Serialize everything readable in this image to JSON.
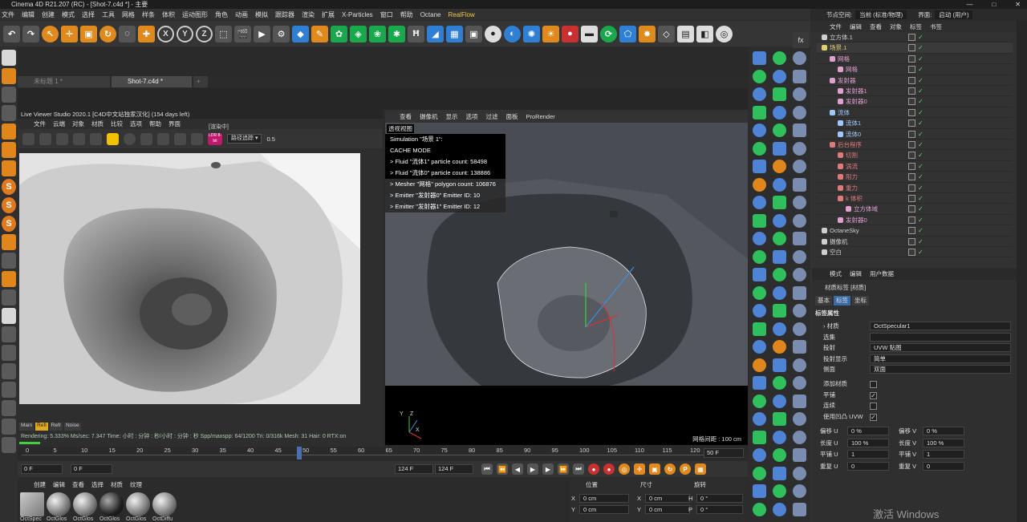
{
  "window": {
    "title": "Cinema 4D R21.207 (RC) - [Shot-7.c4d *] - 主要"
  },
  "menu": [
    "文件",
    "编辑",
    "创建",
    "模式",
    "选择",
    "工具",
    "网格",
    "样条",
    "体积",
    "运动图形",
    "角色",
    "动画",
    "模拟",
    "跟踪器",
    "渲染",
    "扩展",
    "X-Particles",
    "窗口",
    "帮助",
    "Octane",
    "RealFlow"
  ],
  "layout": {
    "node_space_label": "节点空间:",
    "node_space_value": "当前 (标准/物理)",
    "interface_label": "界面:",
    "interface_value": "启动 (用户)"
  },
  "axis_buttons": [
    "X",
    "Y",
    "Z"
  ],
  "doc_tabs": [
    {
      "label": "未标题 1 *"
    },
    {
      "label": "Shot-7.c4d *"
    },
    {
      "label": "+"
    }
  ],
  "live_viewer": {
    "title": "Live Viewer Studio 2020.1 [C4D中文站独家汉化] (154 days left)",
    "menu": [
      "文件",
      "云端",
      "对象",
      "材质",
      "比较",
      "选项",
      "帮助",
      "界面"
    ],
    "status_badge": "[渲染中]",
    "path_mode": "路径追踪",
    "value": "0.5",
    "ldr_label": "LDR 8-bit",
    "tabs": [
      "Main",
      "Refl",
      "Refr",
      "Noise"
    ],
    "status_line": "Rendering: 5.333%  Ms/sec: 7.347   Time: 小时 : 分钟 : 秒/小时 : 分钟 : 秒   Spp/maxspp: 64/1200   Tri: 0/316k   Mesh: 31   Hair: 0   RTX:on"
  },
  "viewport": {
    "menu": [
      "查看",
      "摄像机",
      "显示",
      "选项",
      "过滤",
      "面板",
      "ProRender"
    ],
    "label": "透视视图",
    "overlay_lines": [
      "Simulation \"场景 1\":",
      "CACHE MODE",
      " > Fluid \"流体1\" particle count: 58498",
      " > Fluid \"流体0\" particle count: 138886",
      " > Mesher \"网格\" polygon count: 106876",
      " > Emitter \"发射器0\" Emitter ID: 10",
      " > Emitter \"发射器1\" Emitter ID: 12"
    ],
    "grid_spacing": "网格间距 : 100 cm",
    "axis_labels": [
      "Y",
      "Z",
      "X"
    ]
  },
  "timeline": {
    "ticks": [
      "0",
      "5",
      "10",
      "15",
      "20",
      "25",
      "30",
      "35",
      "40",
      "45",
      "50",
      "55",
      "60",
      "65",
      "70",
      "75",
      "80",
      "85",
      "90",
      "95",
      "100",
      "105",
      "110",
      "115",
      "120"
    ],
    "end": "50 F"
  },
  "transport": {
    "start": "0 F",
    "current": "0 F",
    "end_a": "124 F",
    "end_b": "124 F"
  },
  "materials": {
    "menu": [
      "创建",
      "编辑",
      "查看",
      "选择",
      "材质",
      "纹理"
    ],
    "items": [
      "OctSpec",
      "OctGlos",
      "OctGlos",
      "OctGlos",
      "OctGlos",
      "OctDiffu"
    ]
  },
  "coords": {
    "headers": [
      "位置",
      "尺寸",
      "旋转"
    ],
    "rows": [
      {
        "a": "X",
        "av": "0 cm",
        "b": "X",
        "bv": "0 cm",
        "c": "H",
        "cv": "0 °"
      },
      {
        "a": "Y",
        "av": "0 cm",
        "b": "Y",
        "bv": "0 cm",
        "c": "P",
        "cv": "0 °"
      }
    ]
  },
  "objects": {
    "tabs": [
      "文件",
      "编辑",
      "查看",
      "对象",
      "标签",
      "书签"
    ],
    "items": [
      {
        "name": "立方体.1",
        "indent": 0,
        "color": "#cfcfcf"
      },
      {
        "name": "场景.1",
        "indent": 0,
        "color": "#e0d070"
      },
      {
        "name": "网格",
        "indent": 1,
        "color": "#e0a0d0"
      },
      {
        "name": "网格",
        "indent": 2,
        "color": "#e0a0d0"
      },
      {
        "name": "发射器",
        "indent": 1,
        "color": "#e0a0d0"
      },
      {
        "name": "发射器1",
        "indent": 2,
        "color": "#e0a0d0"
      },
      {
        "name": "发射器0",
        "indent": 2,
        "color": "#e0a0d0"
      },
      {
        "name": "流体",
        "indent": 1,
        "color": "#9fc8ff"
      },
      {
        "name": "流体1",
        "indent": 2,
        "color": "#9fc8ff"
      },
      {
        "name": "流体0",
        "indent": 2,
        "color": "#9fc8ff"
      },
      {
        "name": "后台程序",
        "indent": 1,
        "color": "#e07a7a"
      },
      {
        "name": "切割",
        "indent": 2,
        "color": "#e07a7a"
      },
      {
        "name": "涡流",
        "indent": 2,
        "color": "#e07a7a"
      },
      {
        "name": "阻力",
        "indent": 2,
        "color": "#e07a7a"
      },
      {
        "name": "重力",
        "indent": 2,
        "color": "#e07a7a"
      },
      {
        "name": "k 体积",
        "indent": 2,
        "color": "#e07a7a"
      },
      {
        "name": "立方体域",
        "indent": 3,
        "color": "#e0a0d0"
      },
      {
        "name": "发射器0",
        "indent": 2,
        "color": "#e0a0d0"
      },
      {
        "name": "OctaneSky",
        "indent": 0,
        "color": "#cfcfcf"
      },
      {
        "name": "摄像机",
        "indent": 0,
        "color": "#cfcfcf"
      },
      {
        "name": "空白",
        "indent": 0,
        "color": "#cfcfcf"
      }
    ]
  },
  "attributes": {
    "tabs": [
      "模式",
      "编辑",
      "用户数据"
    ],
    "title": "材质标签 [材质]",
    "subtabs": [
      "基本",
      "标签",
      "坐标"
    ],
    "section": "标签属性",
    "rows": [
      {
        "label": "› 材质",
        "value": "OctSpecular1"
      },
      {
        "label": "选集",
        "value": ""
      },
      {
        "label": "投射",
        "value": "UVW 贴图"
      },
      {
        "label": "投射显示",
        "value": "简单"
      },
      {
        "label": "侧面",
        "value": "双面"
      }
    ],
    "checks": [
      {
        "label": "添加材质",
        "checked": ""
      },
      {
        "label": "平铺",
        "checked": "✓"
      },
      {
        "label": "连续",
        "checked": ""
      },
      {
        "label": "使用凹凸 UVW",
        "checked": "✓"
      }
    ],
    "pairs": [
      {
        "l1": "偏移 U",
        "v1": "0 %",
        "l2": "偏移 V",
        "v2": "0 %"
      },
      {
        "l1": "长度 U",
        "v1": "100 %",
        "l2": "长度 V",
        "v2": "100 %"
      },
      {
        "l1": "平铺 U",
        "v1": "1",
        "l2": "平铺 V",
        "v2": "1"
      },
      {
        "l1": "重复 U",
        "v1": "0",
        "l2": "重复 V",
        "v2": "0"
      }
    ]
  },
  "watermark": "激活 Windows",
  "colors": {
    "accent": "#e0861d",
    "blue": "#2f80d4",
    "green": "#1aa84c"
  }
}
